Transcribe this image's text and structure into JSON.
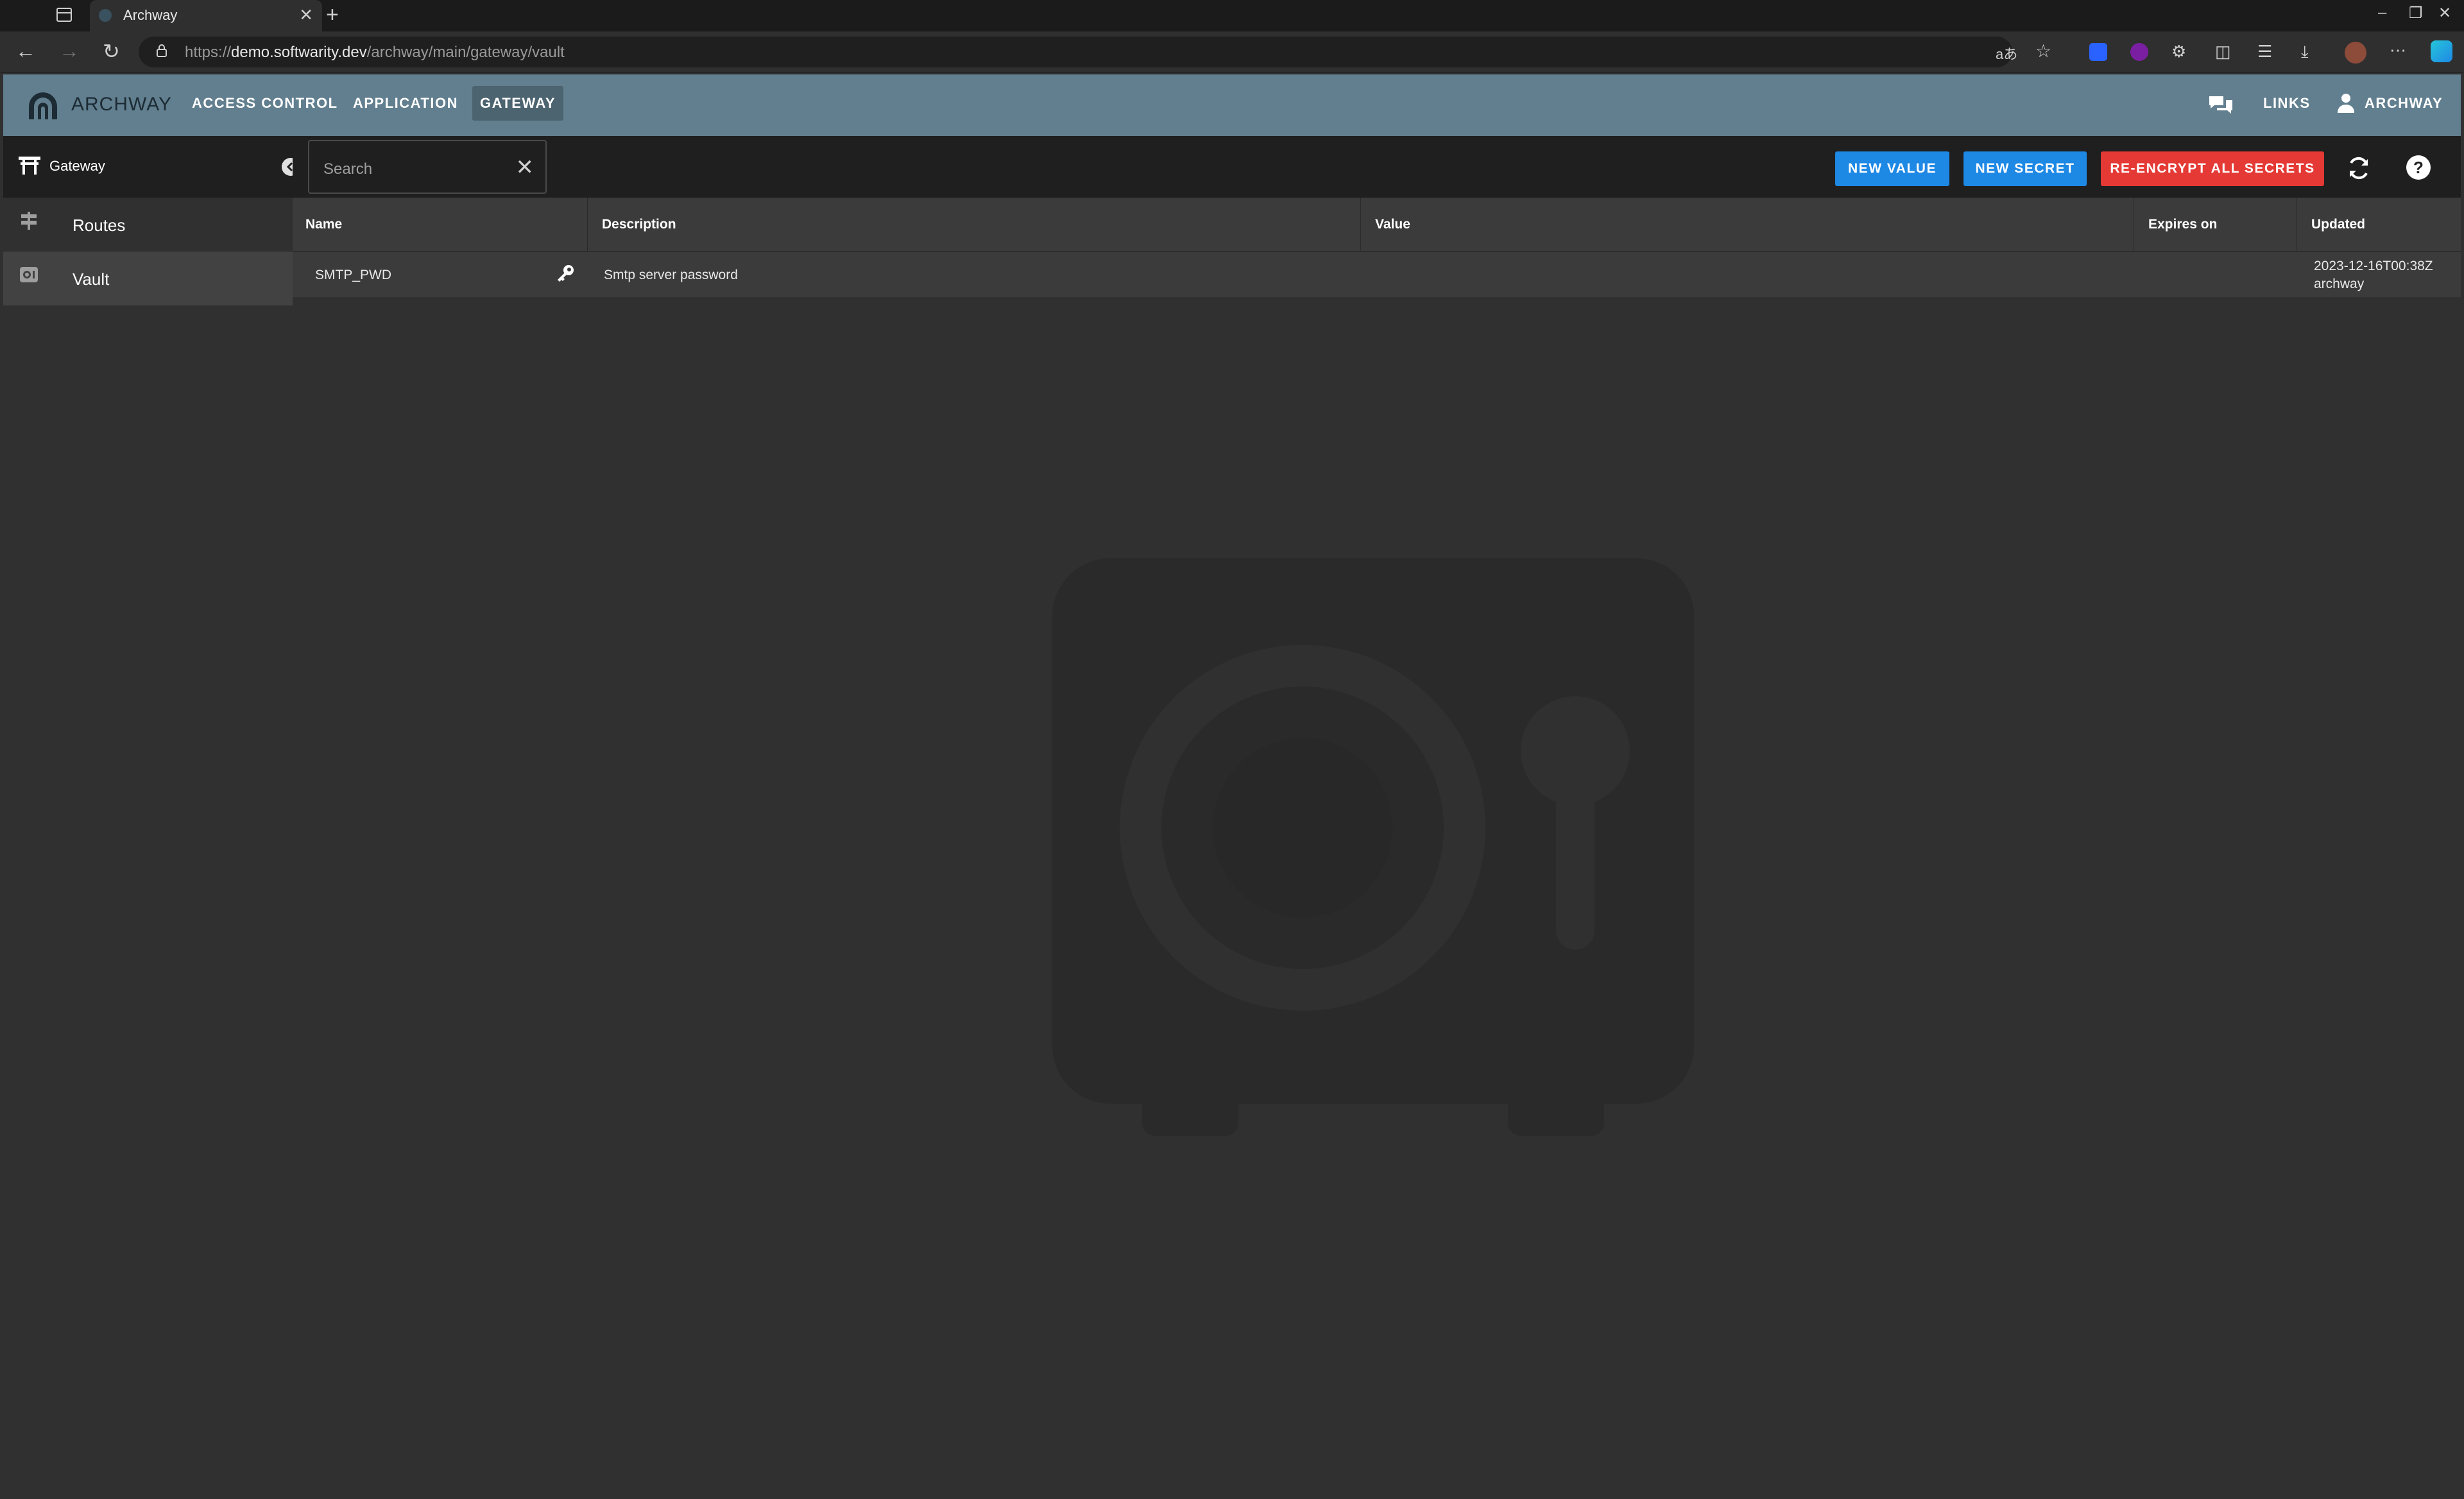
{
  "browser": {
    "tab_title": "Archway",
    "url_prefix": "https://",
    "url_host": "demo.softwarity.dev",
    "url_path": "/archway/main/gateway/vault"
  },
  "header": {
    "brand": "ARCHWAY",
    "nav": [
      "ACCESS CONTROL",
      "APPLICATION",
      "GATEWAY"
    ],
    "active_nav": "GATEWAY",
    "links_label": "LINKS",
    "user_label": "ARCHWAY"
  },
  "sidebar": {
    "section": "Gateway",
    "items": [
      {
        "label": "Routes",
        "icon": "signpost-icon"
      },
      {
        "label": "Vault",
        "icon": "vault-icon"
      }
    ],
    "selected": "Vault"
  },
  "toolbar": {
    "search_placeholder": "Search",
    "new_value": "NEW VALUE",
    "new_secret": "NEW SECRET",
    "reencrypt": "RE-ENCRYPT ALL SECRETS"
  },
  "table": {
    "columns": [
      "Name",
      "Description",
      "Value",
      "Expires on",
      "Updated"
    ],
    "rows": [
      {
        "name": "SMTP_PWD",
        "description": "Smtp server password",
        "value": "",
        "expires_on": "",
        "updated_date": "2023-12-16T00:38Z",
        "updated_by": "archway"
      }
    ]
  },
  "colors": {
    "header_bg": "#627f8f",
    "primary_button": "#1e88e5",
    "danger_button": "#e53935",
    "content_bg": "#303030"
  }
}
